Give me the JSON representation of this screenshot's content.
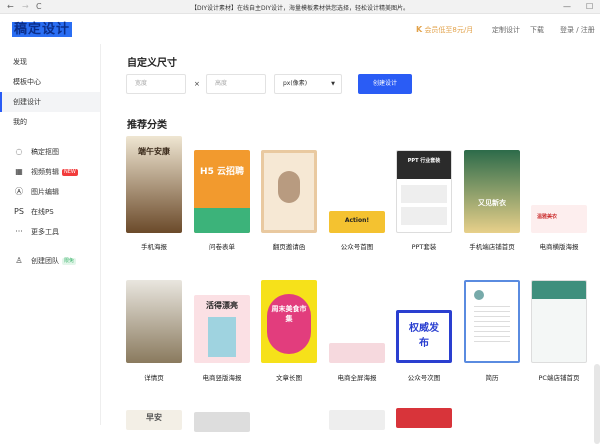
{
  "browser": {
    "title": "【DIY设计素材】在线自主DIY设计，海量模板素材供您选择，轻松设计精美图片。",
    "back": "←",
    "forward": "→",
    "reload": "C",
    "minimize": "—",
    "maximize": "☐"
  },
  "header": {
    "logo": "稿定设计",
    "vip": "会员低至8元/月",
    "custom": "定制设计",
    "download": "下载",
    "login": "登录 / 注册"
  },
  "sidebar": {
    "items": [
      {
        "label": "发现"
      },
      {
        "label": "模板中心"
      },
      {
        "label": "创建设计",
        "active": true
      },
      {
        "label": "我的"
      }
    ],
    "tools": [
      {
        "label": "稿定抠图",
        "icon": "cutout-icon",
        "glyph": "◌"
      },
      {
        "label": "视频剪辑",
        "icon": "film-icon",
        "glyph": "▦",
        "badge": "NEW"
      },
      {
        "label": "图片编辑",
        "icon": "image-edit-icon",
        "glyph": "Ⓐ"
      },
      {
        "label": "在线PS",
        "icon": "ps-icon",
        "glyph": "PS"
      },
      {
        "label": "更多工具",
        "icon": "more-icon",
        "glyph": "···"
      }
    ],
    "team": {
      "label": "创建团队",
      "badge": "限免",
      "glyph": "♙"
    }
  },
  "custom_size": {
    "title": "自定义尺寸",
    "width_placeholder": "宽度",
    "times": "×",
    "height_placeholder": "高度",
    "unit": "px(像素)",
    "create": "创建设计"
  },
  "recommend": {
    "title": "推荐分类",
    "categories": [
      {
        "label": "手机海报",
        "text": "端午安康"
      },
      {
        "label": "问卷表单",
        "text": "H5 云招聘"
      },
      {
        "label": "翻页邀请函",
        "text": ""
      },
      {
        "label": "公众号首图",
        "text": "Action!"
      },
      {
        "label": "PPT套装",
        "text": "PPT 行业套装"
      },
      {
        "label": "手机端店铺首页",
        "text": "又见新衣"
      },
      {
        "label": "电商横版海报",
        "text": "温雅美衣"
      },
      {
        "label": "详情页",
        "text": ""
      },
      {
        "label": "电商竖版海报",
        "text": "活得漂亮"
      },
      {
        "label": "文章长图",
        "text": "周末美食市集"
      },
      {
        "label": "电商全屏海报",
        "text": ""
      },
      {
        "label": "公众号次图",
        "text": "权威发布"
      },
      {
        "label": "简历",
        "text": ""
      },
      {
        "label": "PC端店铺首页",
        "text": ""
      }
    ],
    "partial": [
      {
        "text": "早安"
      }
    ]
  },
  "colors": {
    "accent": "#2a5cf5",
    "vip": "#e2a24a",
    "new_badge": "#f23c3c",
    "free_badge": "#3bb36b"
  }
}
